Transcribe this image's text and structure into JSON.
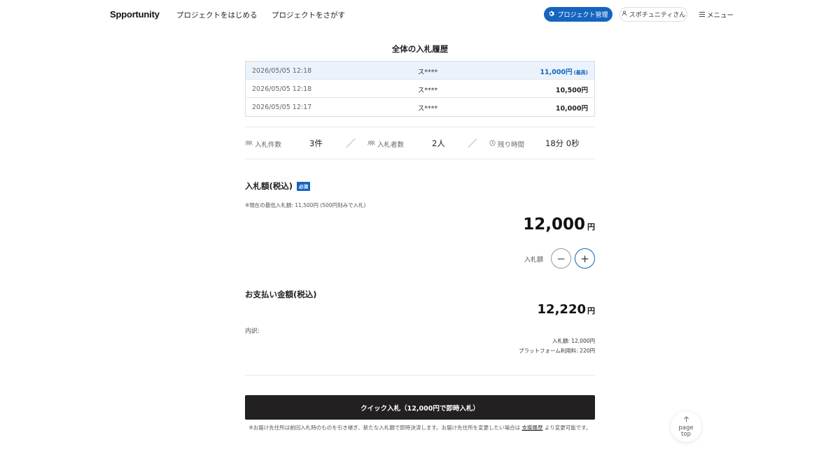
{
  "header": {
    "logo": "Spportunity",
    "nav_start": "プロジェクトをはじめる",
    "nav_search": "プロジェクトをさがす",
    "manage_label": "プロジェクト管理",
    "user_label": "スポチュニティさん",
    "menu_label": "メニュー"
  },
  "history": {
    "title": "全体の入札履歴",
    "rows": [
      {
        "date": "2026/05/05 12:18",
        "user": "ス****",
        "amount": "11,000円",
        "tag": "(最高)"
      },
      {
        "date": "2026/05/05 12:18",
        "user": "ス****",
        "amount": "10,500円",
        "tag": ""
      },
      {
        "date": "2026/05/05 12:17",
        "user": "ス****",
        "amount": "10,000円",
        "tag": ""
      }
    ]
  },
  "stats": {
    "bid_count_label": "入札件数",
    "bid_count_value": "3件",
    "bidders_label": "入札者数",
    "bidders_value": "2人",
    "remaining_label": "残り時間",
    "remaining_value": "18分 0秒",
    "separator": "／"
  },
  "bid": {
    "heading": "入札額(税込)",
    "required": "必須",
    "min_note": "※現在の最低入札額: 11,500円 (500円刻みで入札)",
    "amount": "12,000",
    "unit": "円",
    "stepper_label": "入札額",
    "minus": "−",
    "plus": "+"
  },
  "payment": {
    "heading": "お支払い金額(税込)",
    "amount": "12,220",
    "unit": "円",
    "breakdown_label": "内訳:",
    "line_bid": "入札額: 12,000円",
    "line_fee": "プラットフォーム利用料: 220円"
  },
  "quick_bid": {
    "label": "クイック入札（12,000円で即時入札）",
    "note_pre": "※お届け先住所は前回入札時のものを引き継ぎ、新たな入札額で即時決済します。お届け先住所を変更したい場合は",
    "note_link": "支援履歴",
    "note_post": "より変更可能です。"
  },
  "page_top": {
    "line1": "page",
    "line2": "top"
  },
  "colors": {
    "accent": "#1565c0",
    "highlight_row": "#eaf2fb",
    "button_dark": "#222020"
  }
}
